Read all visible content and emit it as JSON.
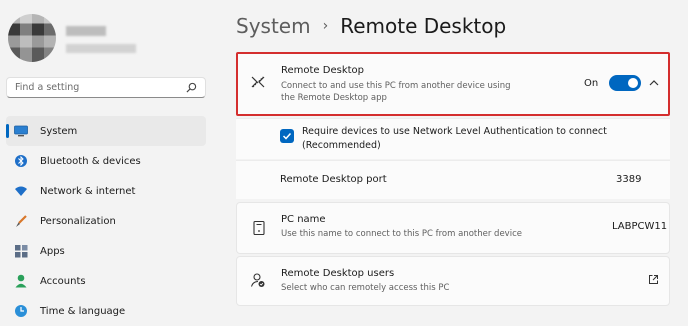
{
  "sidebar": {
    "search_placeholder": "Find a setting",
    "items": [
      {
        "label": "System",
        "icon": "monitor-icon",
        "active": true
      },
      {
        "label": "Bluetooth & devices",
        "icon": "bluetooth-icon"
      },
      {
        "label": "Network & internet",
        "icon": "wifi-icon"
      },
      {
        "label": "Personalization",
        "icon": "brush-icon"
      },
      {
        "label": "Apps",
        "icon": "apps-icon"
      },
      {
        "label": "Accounts",
        "icon": "person-icon"
      },
      {
        "label": "Time & language",
        "icon": "globe-clock-icon"
      }
    ]
  },
  "header": {
    "crumb": "System",
    "separator": "›",
    "current": "Remote Desktop"
  },
  "remote_desktop": {
    "title": "Remote Desktop",
    "subtitle_line1": "Connect to and use this PC from another device using",
    "subtitle_line2": "the Remote Desktop app",
    "state_label": "On",
    "enabled": true
  },
  "nla": {
    "line1": "Require devices to use Network Level Authentication to connect",
    "line2": "(Recommended)",
    "checked": true
  },
  "port": {
    "label": "Remote Desktop port",
    "value": "3389"
  },
  "pc_name": {
    "title": "PC name",
    "subtitle": "Use this name to connect to this PC from another device",
    "value": "LABPCW11"
  },
  "users": {
    "title": "Remote Desktop users",
    "subtitle": "Select who can remotely access this PC"
  },
  "colors": {
    "accent": "#0067c0",
    "highlight_border": "#d42e2e"
  }
}
